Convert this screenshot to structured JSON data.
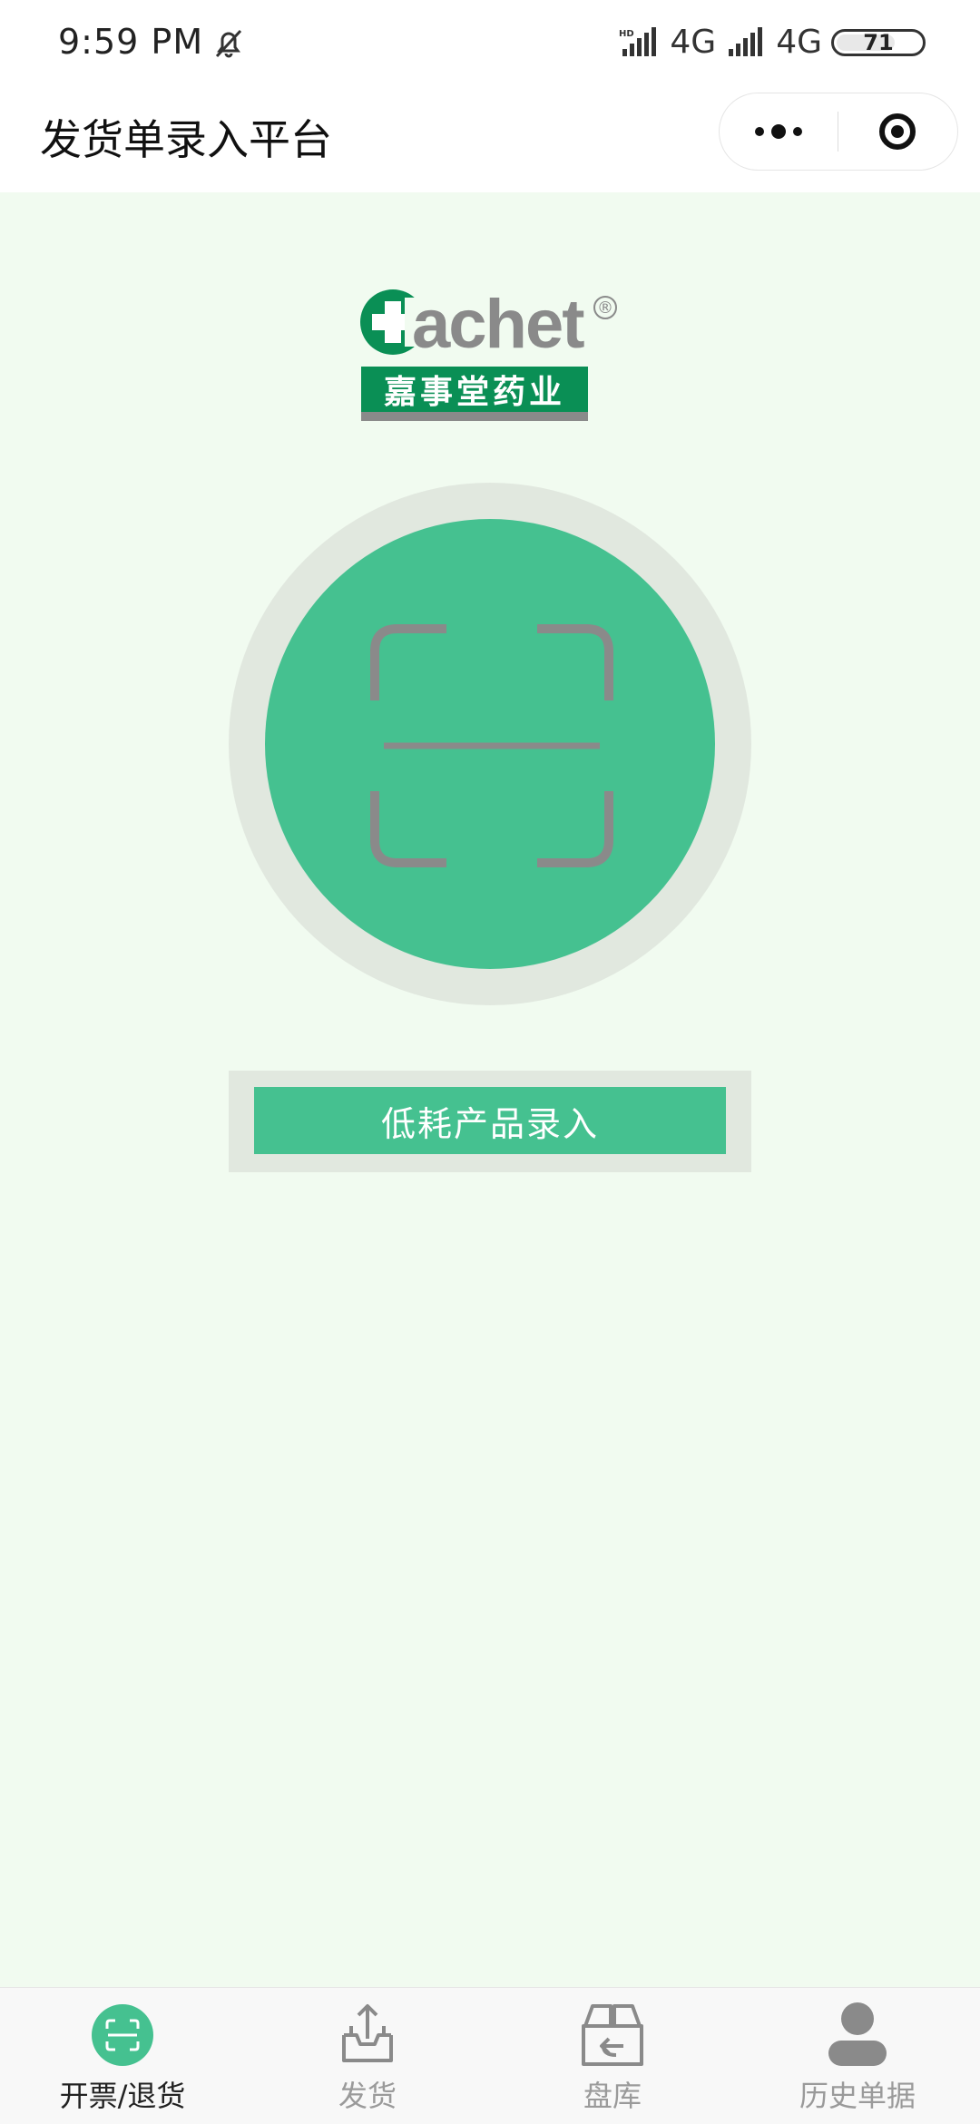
{
  "status_bar": {
    "time": "9:59  PM",
    "net1": "4G",
    "net2": "4G",
    "battery": "71"
  },
  "title_bar": {
    "title": "发货单录入平台"
  },
  "logo": {
    "brand_text": "achet",
    "registered": "®",
    "chinese_name": "嘉事堂药业"
  },
  "main": {
    "scan_button_icon": "scan-icon",
    "low_consumption_button": "低耗产品录入"
  },
  "tabbar": {
    "tabs": [
      {
        "label": "开票/退货",
        "icon": "scan-icon",
        "active": true
      },
      {
        "label": "发货",
        "icon": "outbox-icon",
        "active": false
      },
      {
        "label": "盘库",
        "icon": "return-box-icon",
        "active": false
      },
      {
        "label": "历史单据",
        "icon": "user-icon",
        "active": false
      }
    ]
  },
  "colors": {
    "accent": "#45c190",
    "background": "#f1fbf0",
    "ring": "#e1e8df",
    "logo_green": "#0a8f55"
  }
}
